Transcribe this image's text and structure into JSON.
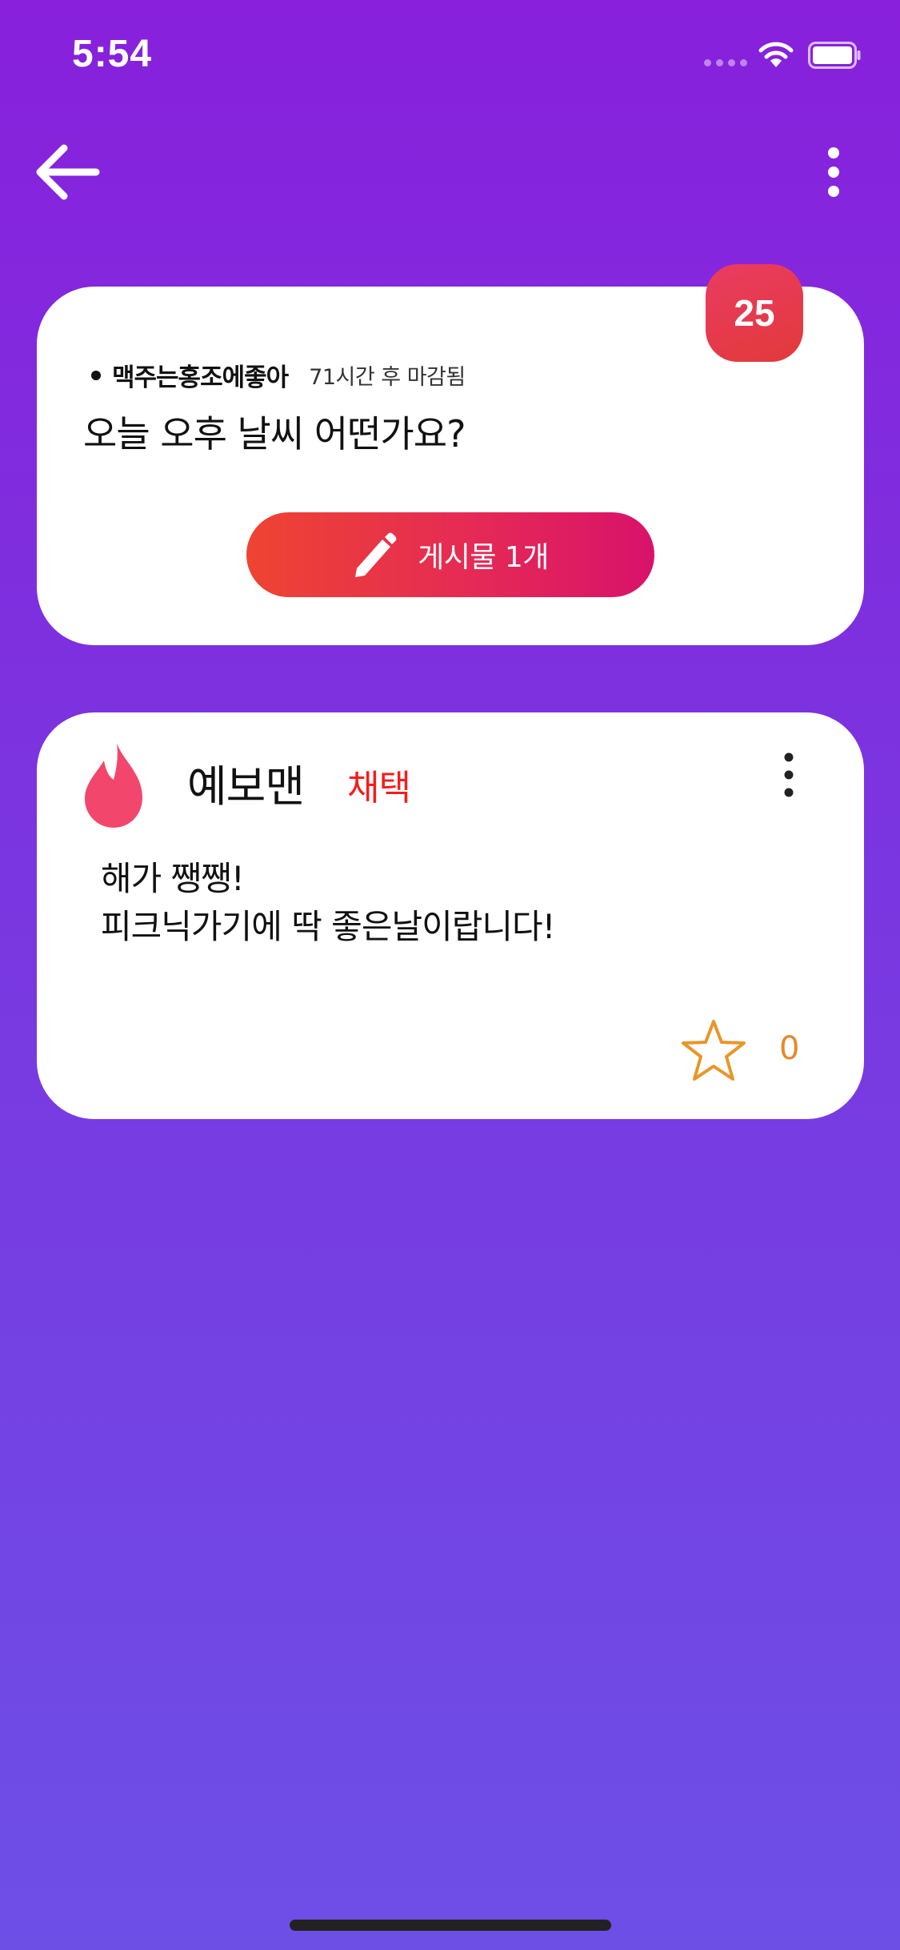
{
  "status_bar": {
    "time": "5:54"
  },
  "nav": {
    "back_icon": "arrow-left-icon",
    "more_icon": "more-vertical-icon"
  },
  "question": {
    "count": "25",
    "author": "맥주는홍조에좋아",
    "deadline": "71시간 후 마감됨",
    "title": "오늘 오후 날씨 어떤가요?",
    "posts_button_label": "게시물 1개",
    "posts_button_icon": "pencil-icon"
  },
  "answer": {
    "author_icon": "flame-icon",
    "author": "예보맨",
    "adopted_label": "채택",
    "body_lines": [
      "해가 쨍쨍!",
      "피크닉가기에 딱 좋은날이랍니다!"
    ],
    "star_icon": "star-icon",
    "star_count": "0"
  },
  "colors": {
    "background_top": "#8820dc",
    "background_bottom": "#6d4fe6",
    "accent_red": "#e52a55",
    "adopted_red": "#f41d1d",
    "star_orange": "#e8882a"
  }
}
